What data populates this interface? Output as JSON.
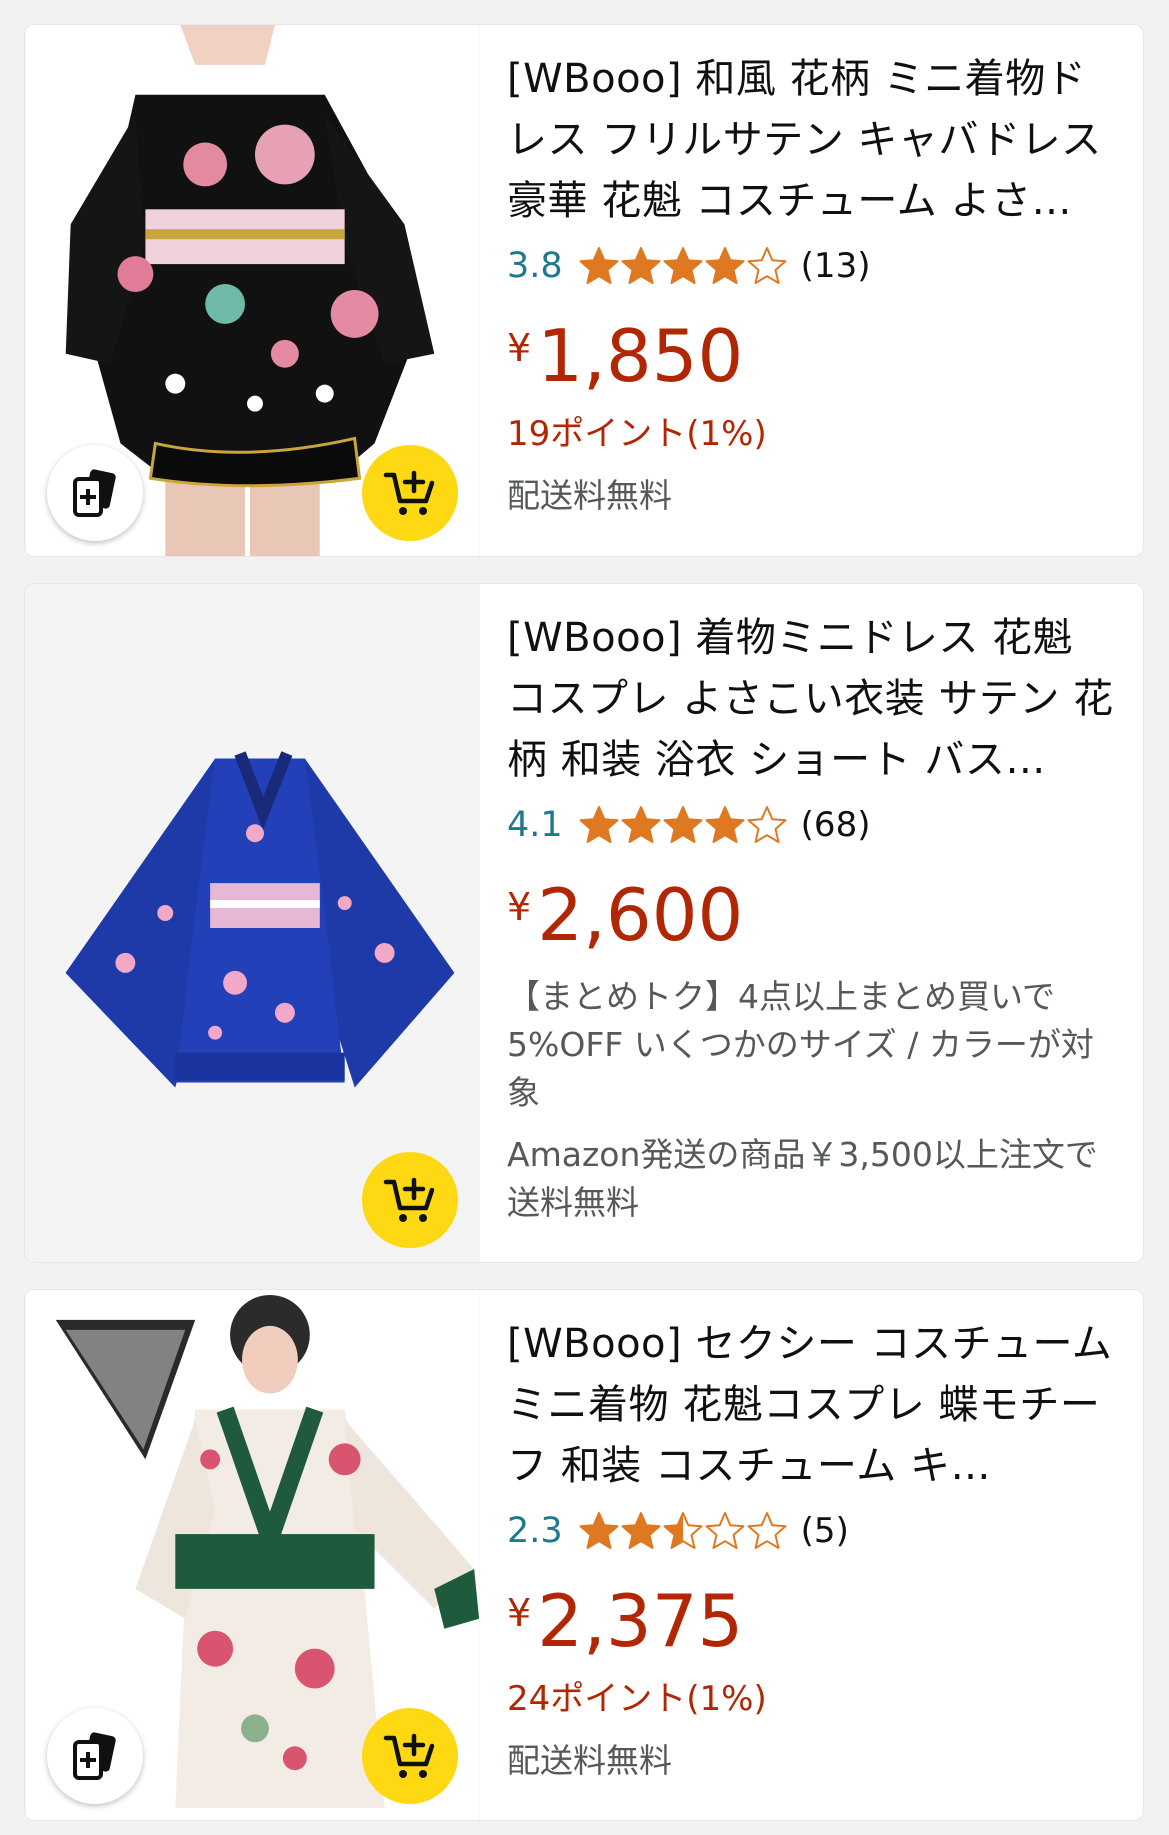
{
  "products": [
    {
      "title": "[WBooo] 和風 花柄 ミニ着物ドレス フリルサテン キャバドレス 豪華 花魁 コスチューム よさ…",
      "rating": "3.8",
      "rating_value": 3.8,
      "review_count": "(13)",
      "currency": "¥",
      "price": "1,850",
      "points": "19ポイント(1%)",
      "shipping": "配送料無料",
      "image_icon": "black-floral-kimono-dress",
      "has_compare": true
    },
    {
      "title": "[WBooo] 着物ミニドレス 花魁 コスプレ よさこい衣装 サテン 花柄 和装 浴衣 ショート バス…",
      "rating": "4.1",
      "rating_value": 4.1,
      "review_count": "(68)",
      "currency": "¥",
      "price": "2,600",
      "promo": "【まとめトク】4点以上まとめ買いで5%OFF いくつかのサイズ / カラーが対象",
      "shipping": "Amazon発送の商品￥3,500以上注文で送料無料",
      "image_icon": "blue-floral-kimono-dress",
      "has_compare": false
    },
    {
      "title": "[WBooo] セクシー コスチューム ミニ着物 花魁コスプレ 蝶モチーフ 和装 コスチューム キ…",
      "rating": "2.3",
      "rating_value": 2.3,
      "review_count": "(5)",
      "currency": "¥",
      "price": "2,375",
      "points": "24ポイント(1%)",
      "shipping": "配送料無料",
      "image_icon": "white-green-floral-kimono-with-fan",
      "has_compare": true
    }
  ],
  "icons": {
    "cart": "add-to-cart-icon",
    "compare": "compare-cards-icon",
    "star": "star-icon"
  },
  "colors": {
    "price": "#b12704",
    "rating": "#1d7a8c",
    "star": "#de7921",
    "cart_button": "#ffd814"
  }
}
